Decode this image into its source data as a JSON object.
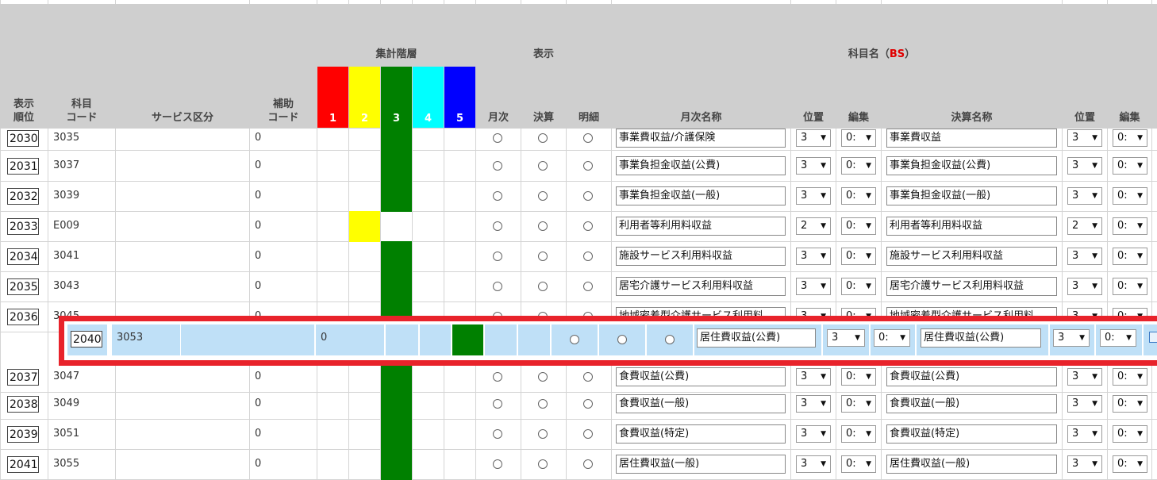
{
  "header": {
    "group_level": "集計階層",
    "group_display": "表示",
    "group_name": "科目名（",
    "group_name_bs": "BS",
    "group_name_close": "）",
    "col_order": "表示\n順位",
    "col_code": "科目\nコード",
    "col_service": "サービス区分",
    "col_sub": "補助\nコード",
    "levels": [
      {
        "label": "1",
        "color": "#ff0000"
      },
      {
        "label": "2",
        "color": "#ffff00"
      },
      {
        "label": "3",
        "color": "#008000"
      },
      {
        "label": "4",
        "color": "#00ffff"
      },
      {
        "label": "5",
        "color": "#0000ff"
      }
    ],
    "col_monthly": "月次",
    "col_settle": "決算",
    "col_detail": "明細",
    "col_monthly_name": "月次名称",
    "col_pos": "位置",
    "col_edit": "編集",
    "col_settle_name": "決算名称",
    "col_pos2": "位置",
    "col_edit2": "編集"
  },
  "rows": [
    {
      "order": "2030",
      "code": "3035",
      "sub": "0",
      "level": 3,
      "monthly_name": "事業費収益/介護保険",
      "pos": "3",
      "edit": "0:",
      "settle_name": "事業費収益",
      "pos2": "3",
      "edit2": "0:"
    },
    {
      "order": "2031",
      "code": "3037",
      "sub": "0",
      "level": 3,
      "monthly_name": "事業負担金収益(公費)",
      "pos": "3",
      "edit": "0:",
      "settle_name": "事業負担金収益(公費)",
      "pos2": "3",
      "edit2": "0:"
    },
    {
      "order": "2032",
      "code": "3039",
      "sub": "0",
      "level": 3,
      "monthly_name": "事業負担金収益(一般)",
      "pos": "3",
      "edit": "0:",
      "settle_name": "事業負担金収益(一般)",
      "pos2": "3",
      "edit2": "0:"
    },
    {
      "order": "2033",
      "code": "E009",
      "sub": "0",
      "level": 2,
      "monthly_name": "利用者等利用料収益",
      "pos": "2",
      "edit": "0:",
      "settle_name": "利用者等利用料収益",
      "pos2": "2",
      "edit2": "0:"
    },
    {
      "order": "2034",
      "code": "3041",
      "sub": "0",
      "level": 3,
      "monthly_name": "施設サービス利用料収益",
      "pos": "3",
      "edit": "0:",
      "settle_name": "施設サービス利用料収益",
      "pos2": "3",
      "edit2": "0:"
    },
    {
      "order": "2035",
      "code": "3043",
      "sub": "0",
      "level": 3,
      "monthly_name": "居宅介護サービス利用料収益",
      "pos": "3",
      "edit": "0:",
      "settle_name": "居宅介護サービス利用料収益",
      "pos2": "3",
      "edit2": "0:"
    },
    {
      "order": "2036",
      "code": "3045",
      "sub": "0",
      "level": 3,
      "monthly_name": "地域密着型介護サービス利用料",
      "pos": "3",
      "edit": "0:",
      "settle_name": "地域密着型介護サービス利用料",
      "pos2": "3",
      "edit2": "0:"
    },
    {
      "order": "2037",
      "code": "3047",
      "sub": "0",
      "level": 3,
      "monthly_name": "食費収益(公費)",
      "pos": "3",
      "edit": "0:",
      "settle_name": "食費収益(公費)",
      "pos2": "3",
      "edit2": "0:"
    },
    {
      "order": "2038",
      "code": "3049",
      "sub": "0",
      "level": 3,
      "monthly_name": "食費収益(一般)",
      "pos": "3",
      "edit": "0:",
      "settle_name": "食費収益(一般)",
      "pos2": "3",
      "edit2": "0:"
    },
    {
      "order": "2039",
      "code": "3051",
      "sub": "0",
      "level": 3,
      "monthly_name": "食費収益(特定)",
      "pos": "3",
      "edit": "0:",
      "settle_name": "食費収益(特定)",
      "pos2": "3",
      "edit2": "0:"
    },
    {
      "order": "2041",
      "code": "3055",
      "sub": "0",
      "level": 3,
      "monthly_name": "居住費収益(一般)",
      "pos": "3",
      "edit": "0:",
      "settle_name": "居住費収益(一般)",
      "pos2": "3",
      "edit2": "0:"
    }
  ],
  "dragged_row": {
    "order": "2040",
    "code": "3053",
    "sub": "0",
    "level": 3,
    "monthly_name": "居住費収益(公費)",
    "pos": "3",
    "edit": "0:",
    "settle_name": "居住費収益(公費)",
    "pos2": "3",
    "edit2": "0:"
  }
}
